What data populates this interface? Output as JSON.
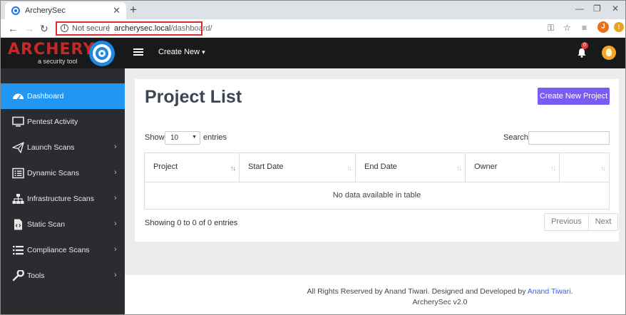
{
  "browser": {
    "tab_title": "ArcherySec",
    "tab_close": "✕",
    "new_tab": "+",
    "not_secure": "Not secure",
    "url_host": "archerysec.local",
    "url_path": "/dashboard/",
    "profile_initial": "J"
  },
  "app": {
    "logo_text": "ARCHERY",
    "logo_subtitle": "a security tool",
    "create_new": "Create New",
    "notification_count": "0"
  },
  "sidebar": {
    "items": [
      {
        "label": "Dashboard",
        "has_arrow": false,
        "icon": "dashboard-gauge-icon"
      },
      {
        "label": "Pentest Activity",
        "has_arrow": false,
        "icon": "monitor-icon"
      },
      {
        "label": "Launch Scans",
        "has_arrow": true,
        "icon": "paper-plane-icon"
      },
      {
        "label": "Dynamic Scans",
        "has_arrow": true,
        "icon": "list-alt-icon"
      },
      {
        "label": "Infrastructure Scans",
        "has_arrow": true,
        "icon": "sitemap-icon"
      },
      {
        "label": "Static Scan",
        "has_arrow": true,
        "icon": "code-file-icon"
      },
      {
        "label": "Compliance Scans",
        "has_arrow": true,
        "icon": "list-icon"
      },
      {
        "label": "Tools",
        "has_arrow": true,
        "icon": "wrench-icon"
      }
    ]
  },
  "main": {
    "title": "Project List",
    "create_button": "Create New Project",
    "show_label": "Show",
    "page_length": "10",
    "entries_label": "entries",
    "search_label": "Search:",
    "columns": [
      "Project",
      "Start Date",
      "End Date",
      "Owner",
      ""
    ],
    "empty_message": "No data available in table",
    "info": "Showing 0 to 0 of 0 entries",
    "pagination": {
      "previous": "Previous",
      "next": "Next"
    }
  },
  "footer": {
    "prefix": "All Rights Reserved by Anand Tiwari. Designed and Developed by ",
    "author_link": "Anand Tiwari",
    "suffix": ".",
    "version": "ArcherySec v2.0"
  },
  "colors": {
    "accent_blue": "#2196f3",
    "create_button": "#7b5cf0",
    "sidebar_bg": "#2a2c30",
    "topbar_bg": "#18191b",
    "logo_red": "#c62828"
  }
}
